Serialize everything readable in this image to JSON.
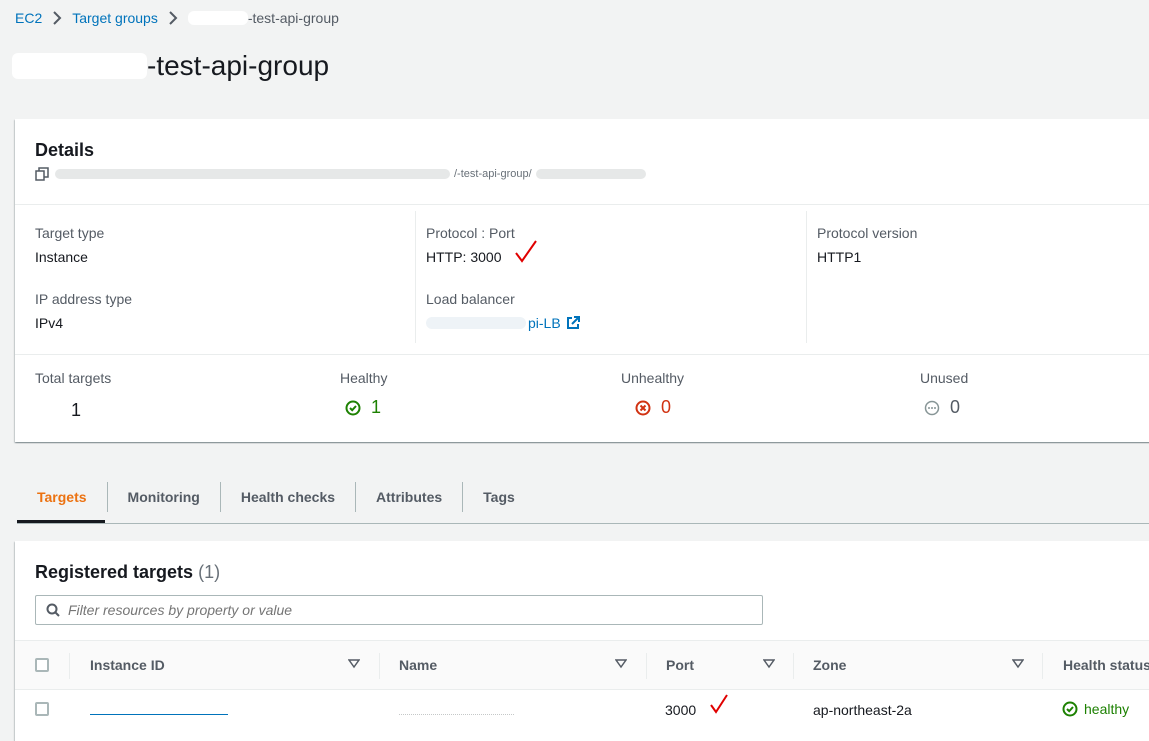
{
  "breadcrumb": {
    "items": [
      "EC2",
      "Target groups"
    ],
    "current": "-test-api-group"
  },
  "page": {
    "title": "-test-api-group"
  },
  "details": {
    "title": "Details",
    "arn": "/-test-api-group/",
    "target_type_label": "Target type",
    "target_type": "Instance",
    "protocol_port_label": "Protocol : Port",
    "protocol_port": "HTTP: 3000",
    "protocol_version_label": "Protocol version",
    "protocol_version": "HTTP1",
    "ip_type_label": "IP address type",
    "ip_type": "IPv4",
    "lb_label": "Load balancer",
    "lb": "pi-LB",
    "stats": {
      "total_label": "Total targets",
      "total": "1",
      "healthy_label": "Healthy",
      "healthy": "1",
      "unhealthy_label": "Unhealthy",
      "unhealthy": "0",
      "unused_label": "Unused",
      "unused": "0"
    }
  },
  "tabs": [
    "Targets",
    "Monitoring",
    "Health checks",
    "Attributes",
    "Tags"
  ],
  "targets": {
    "title": "Registered targets",
    "count": "(1)",
    "filter_placeholder": "Filter resources by property or value",
    "columns": [
      "Instance ID",
      "Name",
      "Port",
      "Zone",
      "Health status"
    ],
    "rows": [
      {
        "port": "3000",
        "zone": "ap-northeast-2a",
        "health": "healthy"
      }
    ]
  },
  "colors": {
    "link": "#0073bb",
    "active_tab": "#ec7211",
    "healthy": "#1d8102",
    "unhealthy": "#d13212",
    "unused": "#879596",
    "annotation_check": "#e00000"
  },
  "icons": [
    "chevron-right-icon",
    "copy-icon",
    "external-link-icon",
    "check-circle-icon",
    "x-circle-icon",
    "ellipsis-circle-icon",
    "search-icon",
    "sort-icon",
    "red-checkmark-annotation"
  ]
}
